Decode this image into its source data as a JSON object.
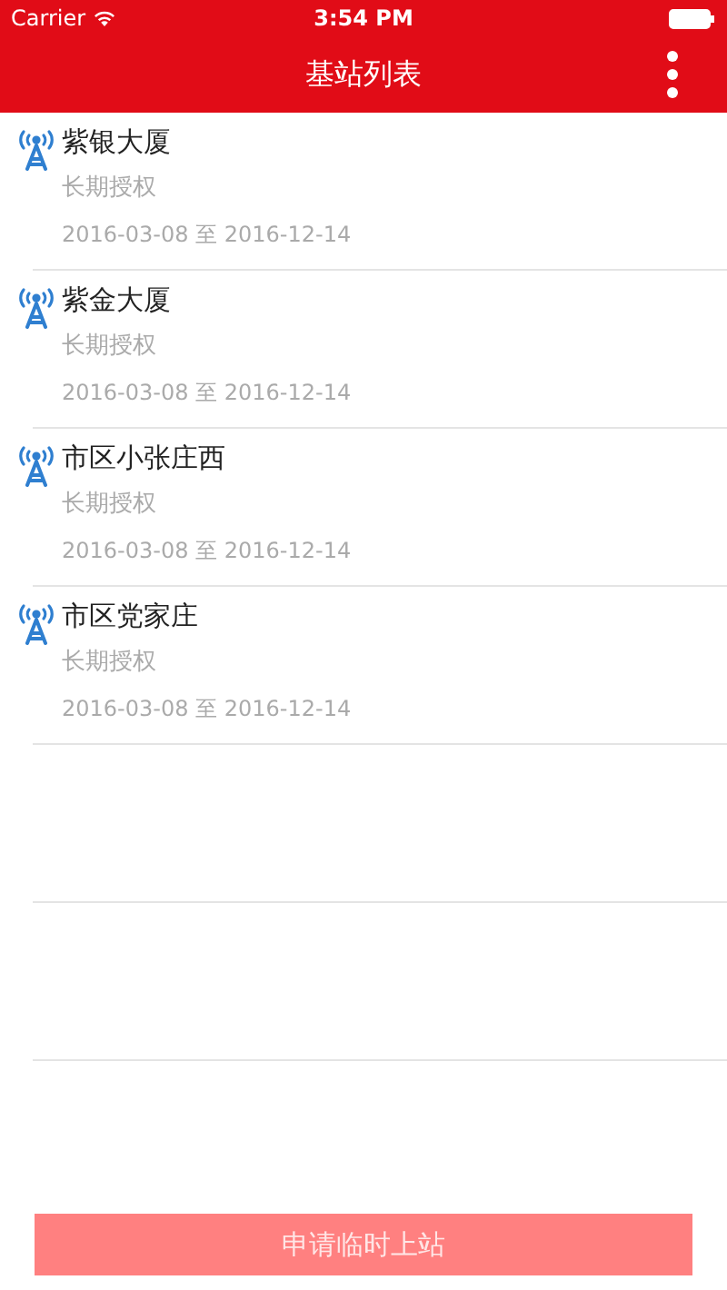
{
  "status_bar": {
    "carrier": "Carrier",
    "time": "3:54 PM"
  },
  "nav_bar": {
    "title": "基站列表"
  },
  "stations": [
    {
      "name": "紫银大厦",
      "auth": "长期授权",
      "start": "2016-03-08",
      "sep": "至",
      "end": "2016-12-14"
    },
    {
      "name": "紫金大厦",
      "auth": "长期授权",
      "start": "2016-03-08",
      "sep": "至",
      "end": "2016-12-14"
    },
    {
      "name": "市区小张庄西",
      "auth": "长期授权",
      "start": "2016-03-08",
      "sep": "至",
      "end": "2016-12-14"
    },
    {
      "name": "市区党家庄",
      "auth": "长期授权",
      "start": "2016-03-08",
      "sep": "至",
      "end": "2016-12-14"
    }
  ],
  "apply_button": {
    "label": "申请临时上站",
    "disabled": true
  }
}
